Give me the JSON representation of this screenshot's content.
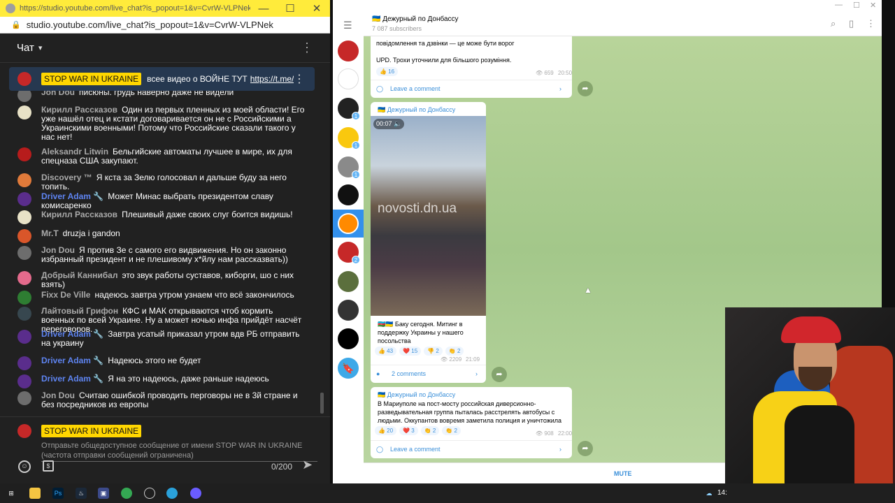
{
  "browser": {
    "title": "https://studio.youtube.com/live_chat?is_popout=1&v=CvrW-VLPNek - ...",
    "url": "studio.youtube.com/live_chat?is_popout=1&v=CvrW-VLPNek"
  },
  "chat": {
    "header": "Чат",
    "pinned": {
      "badge": "STOP WAR IN UKRAINE",
      "text": "всее видео о ВОЙНЕ ТУТ",
      "link": "https://t.me/stop..."
    },
    "messages": [
      {
        "author": "Jon Dou",
        "text": "писюны. грудь наверно даже не видели",
        "mod": false,
        "avatar": "#6d6d6d"
      },
      {
        "author": "Кирилл Рассказов",
        "text": "Один из первых пленных из моей области! Его уже нашёл отец и кстати договаривается он не с Российскими а Украинскими военными! Потому что Российские сказали такого у нас нет!",
        "mod": false,
        "avatar": "#e8e2c7"
      },
      {
        "author": "Aleksandr Litwin",
        "text": "Бельгийские автоматы лучшее в мире, их для спецназа США закупают.",
        "mod": false,
        "avatar": "#b71c1c"
      },
      {
        "author": "Discovery ™",
        "text": "Я кста за Зелю голосовал и дальше буду за него топить.",
        "mod": false,
        "avatar": "#e07a3a"
      },
      {
        "author": "Driver Adam 🔧",
        "text": "Может Минас выбрать президентом славу комисаренко",
        "mod": true,
        "avatar": "#5a2d8c"
      },
      {
        "author": "Кирилл Рассказов",
        "text": "Плешивый даже своих слуг боится видишь!",
        "mod": false,
        "avatar": "#e8e2c7"
      },
      {
        "author": "Mr.T",
        "text": "druzja i gandon",
        "mod": false,
        "avatar": "#d9562a"
      },
      {
        "author": "Jon Dou",
        "text": "Я против Зе с самого его видвижения. Но он законно избранный президент и не плешивому х*йлу нам рассказвать))",
        "mod": false,
        "avatar": "#6d6d6d"
      },
      {
        "author": "Добрый Каннибал",
        "text": "это звук работы суставов, киборги, шо с них взять)",
        "mod": false,
        "avatar": "#e46a8c"
      },
      {
        "author": "Fixx De Ville",
        "text": "надеюсь завтра утром узнаем что всё закончилось",
        "mod": false,
        "avatar": "#2e7d32"
      },
      {
        "author": "Лайтовый Грифон",
        "text": "КФС и МАК открываются чтоб кормить военных по всей Украине. Ну а может ночью инфа прийдёт насчёт переговоров.",
        "mod": false,
        "avatar": "#37474f"
      },
      {
        "author": "Driver Adam 🔧",
        "text": "Завтра усатый приказал утром вдв РБ отправить на украину",
        "mod": true,
        "avatar": "#5a2d8c"
      },
      {
        "author": "Driver Adam 🔧",
        "text": "Надеюсь этого не будет",
        "mod": true,
        "avatar": "#5a2d8c"
      },
      {
        "author": "Driver Adam 🔧",
        "text": "Я на это надеюсь, даже раньше надеюсь",
        "mod": true,
        "avatar": "#5a2d8c"
      },
      {
        "author": "Jon Dou",
        "text": "Считаю ошибкой проводить перговоры не в 3й стране и без посредников из европы",
        "mod": false,
        "avatar": "#6d6d6d"
      }
    ],
    "compose": {
      "badge": "STOP WAR IN UKRAINE",
      "hint": "Отправьте общедоступное сообщение от имени STOP WAR IN UKRAINE (частота отправки сообщений ограничена)",
      "counter": "0/200"
    }
  },
  "telegram": {
    "channel": "🇺🇦 Дежурный по Донбассу",
    "subscribers": "7 087 subscribers",
    "post1": {
      "text_partial": "повідомлення та дзвінки — це може бути ворог",
      "upd": "UPD. Трохи уточнили для більшого розуміння.",
      "reaction": "👍 16",
      "views": "659",
      "time": "20:50",
      "comment": "Leave a comment"
    },
    "post2": {
      "channel": "🇺🇦 Дежурный по Донбассу",
      "video_time": "00:07",
      "watermark": "novosti.dn.ua",
      "text": "🇦🇿🇺🇦 Баку сегодня. Митинг в поддержку Украины у нашего посольства",
      "reactions": [
        "👍 43",
        "❤️ 15",
        "👎 2",
        "👏 2"
      ],
      "views": "2209",
      "time": "21:09",
      "comments": "2 comments"
    },
    "post3": {
      "channel": "🇺🇦 Дежурный по Донбассу",
      "text": "В Мариуполе на пост-мосту российская диверсионно-разведывательная группа пыталась расстрелять автобусы с людьми. Оккупантов вовремя заметила полиция и уничтожила",
      "reactions": [
        "👍 20",
        "❤️ 3",
        "👏 2",
        "👏 2"
      ],
      "views": "908",
      "time": "22:00",
      "comment": "Leave a comment"
    },
    "mute": "MUTE"
  },
  "taskbar": {
    "clock": "14:"
  }
}
